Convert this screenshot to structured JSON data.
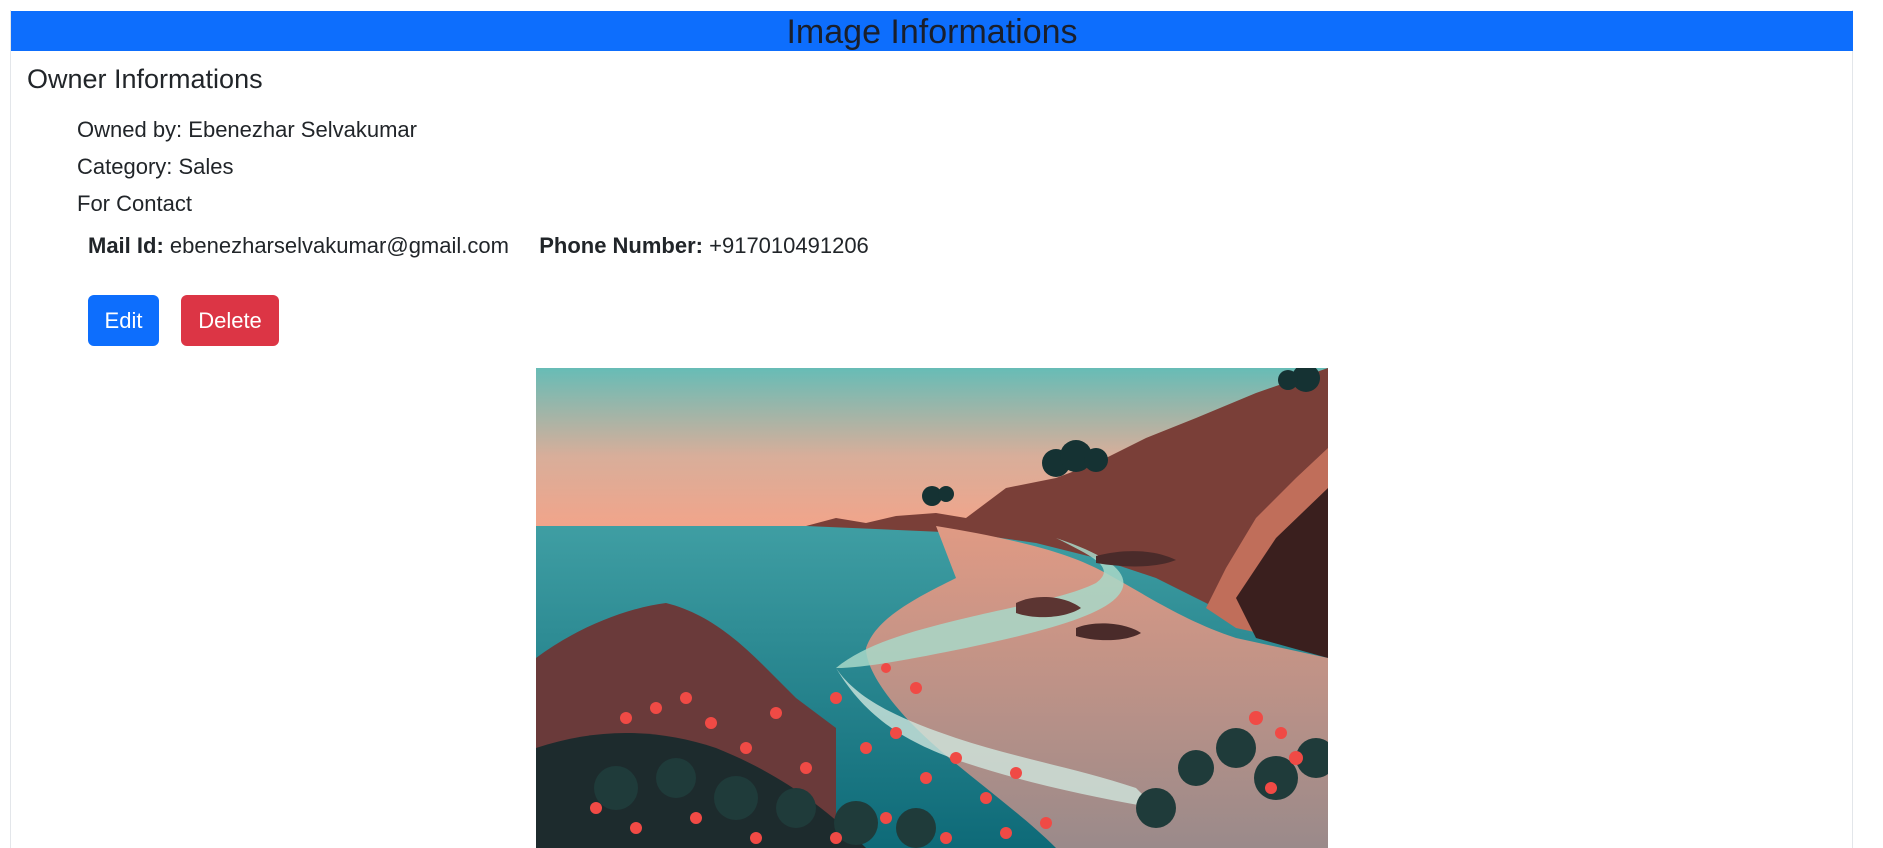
{
  "page": {
    "title": "Image Informations"
  },
  "owner": {
    "heading": "Owner Informations",
    "owned_by": "Owned by: Ebenezhar Selvakumar",
    "category": "Category: Sales",
    "for_contact": "For Contact",
    "mail_label": "Mail Id:",
    "mail_value": "ebenezharselvakumar@gmail.com",
    "phone_label": "Phone Number:",
    "phone_value": "+917010491206"
  },
  "actions": {
    "edit_label": "Edit",
    "delete_label": "Delete"
  },
  "colors": {
    "primary": "#0d6efd",
    "danger": "#dc3545"
  }
}
